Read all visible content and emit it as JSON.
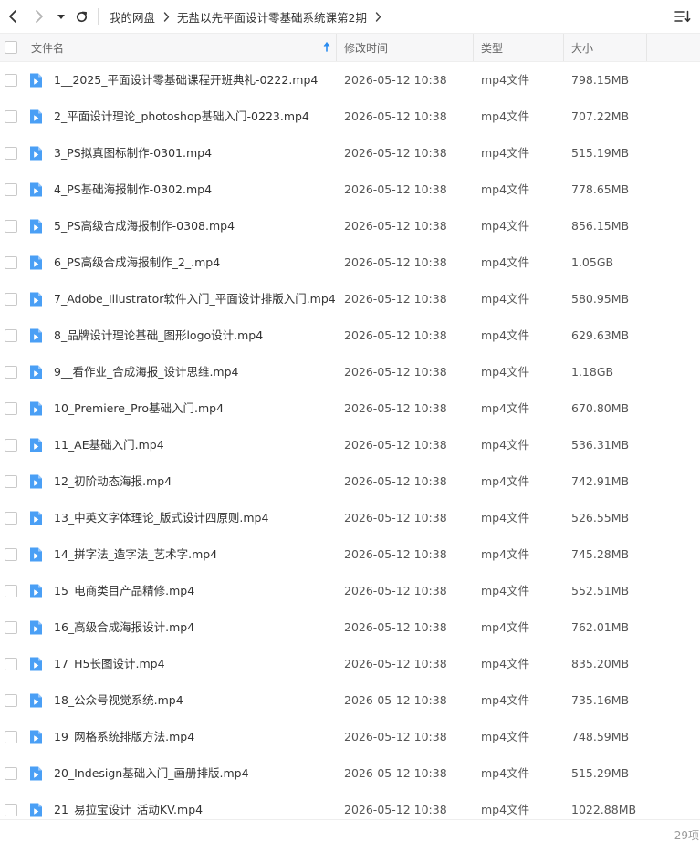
{
  "toolbar": {
    "back_icon": "chevron-left-icon",
    "forward_icon": "chevron-right-icon",
    "history_icon": "caret-down-icon",
    "refresh_icon": "refresh-icon",
    "sort_icon": "sort-list-icon",
    "breadcrumb": [
      "我的网盘",
      "无盐以先平面设计零基础系统课第2期"
    ]
  },
  "table": {
    "columns": {
      "name": "文件名",
      "modified": "修改时间",
      "type": "类型",
      "size": "大小"
    },
    "sort_column": "name",
    "rows": [
      {
        "name": "1__2025_平面设计零基础课程开班典礼-0222.mp4",
        "modified": "2026-05-12 10:38",
        "type": "mp4文件",
        "size": "798.15MB"
      },
      {
        "name": "2_平面设计理论_photoshop基础入门-0223.mp4",
        "modified": "2026-05-12 10:38",
        "type": "mp4文件",
        "size": "707.22MB"
      },
      {
        "name": "3_PS拟真图标制作-0301.mp4",
        "modified": "2026-05-12 10:38",
        "type": "mp4文件",
        "size": "515.19MB"
      },
      {
        "name": "4_PS基础海报制作-0302.mp4",
        "modified": "2026-05-12 10:38",
        "type": "mp4文件",
        "size": "778.65MB"
      },
      {
        "name": "5_PS高级合成海报制作-0308.mp4",
        "modified": "2026-05-12 10:38",
        "type": "mp4文件",
        "size": "856.15MB"
      },
      {
        "name": "6_PS高级合成海报制作_2_.mp4",
        "modified": "2026-05-12 10:38",
        "type": "mp4文件",
        "size": "1.05GB"
      },
      {
        "name": "7_Adobe_Illustrator软件入门_平面设计排版入门.mp4",
        "modified": "2026-05-12 10:38",
        "type": "mp4文件",
        "size": "580.95MB"
      },
      {
        "name": "8_品牌设计理论基础_图形logo设计.mp4",
        "modified": "2026-05-12 10:38",
        "type": "mp4文件",
        "size": "629.63MB"
      },
      {
        "name": "9__看作业_合成海报_设计思维.mp4",
        "modified": "2026-05-12 10:38",
        "type": "mp4文件",
        "size": "1.18GB"
      },
      {
        "name": "10_Premiere_Pro基础入门.mp4",
        "modified": "2026-05-12 10:38",
        "type": "mp4文件",
        "size": "670.80MB"
      },
      {
        "name": "11_AE基础入门.mp4",
        "modified": "2026-05-12 10:38",
        "type": "mp4文件",
        "size": "536.31MB"
      },
      {
        "name": "12_初阶动态海报.mp4",
        "modified": "2026-05-12 10:38",
        "type": "mp4文件",
        "size": "742.91MB"
      },
      {
        "name": "13_中英文字体理论_版式设计四原则.mp4",
        "modified": "2026-05-12 10:38",
        "type": "mp4文件",
        "size": "526.55MB"
      },
      {
        "name": "14_拼字法_造字法_艺术字.mp4",
        "modified": "2026-05-12 10:38",
        "type": "mp4文件",
        "size": "745.28MB"
      },
      {
        "name": "15_电商类目产品精修.mp4",
        "modified": "2026-05-12 10:38",
        "type": "mp4文件",
        "size": "552.51MB"
      },
      {
        "name": "16_高级合成海报设计.mp4",
        "modified": "2026-05-12 10:38",
        "type": "mp4文件",
        "size": "762.01MB"
      },
      {
        "name": "17_H5长图设计.mp4",
        "modified": "2026-05-12 10:38",
        "type": "mp4文件",
        "size": "835.20MB"
      },
      {
        "name": "18_公众号视觉系统.mp4",
        "modified": "2026-05-12 10:38",
        "type": "mp4文件",
        "size": "735.16MB"
      },
      {
        "name": "19_网格系统排版方法.mp4",
        "modified": "2026-05-12 10:38",
        "type": "mp4文件",
        "size": "748.59MB"
      },
      {
        "name": "20_Indesign基础入门_画册排版.mp4",
        "modified": "2026-05-12 10:38",
        "type": "mp4文件",
        "size": "515.29MB"
      },
      {
        "name": "21_易拉宝设计_活动KV.mp4",
        "modified": "2026-05-12 10:38",
        "type": "mp4文件",
        "size": "1022.88MB"
      }
    ]
  },
  "footer": {
    "count": "29项"
  },
  "colors": {
    "accent": "#2b8cf0",
    "file_icon": "#4a9ff5"
  }
}
